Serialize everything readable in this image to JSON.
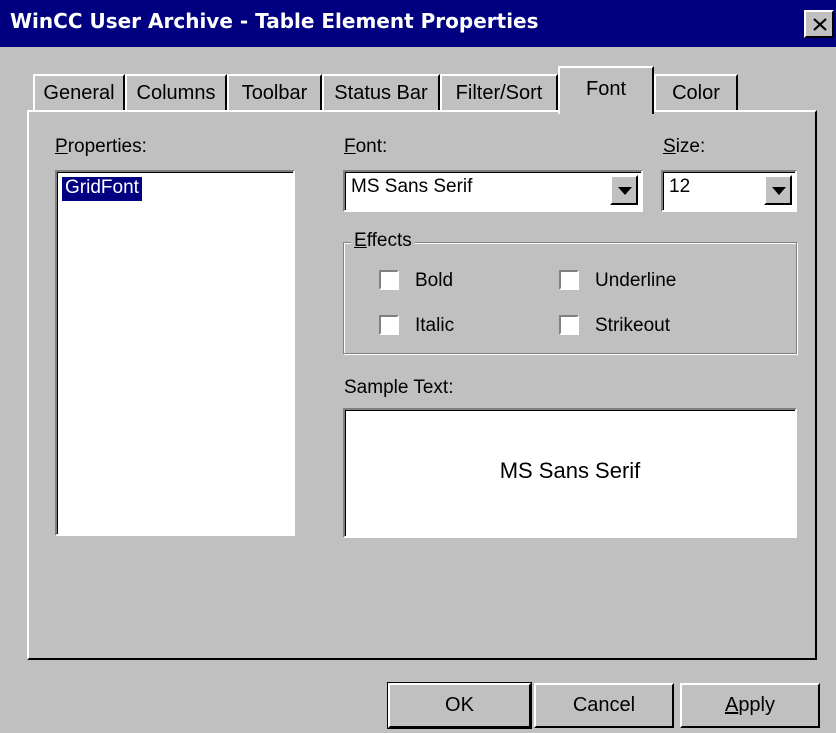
{
  "window": {
    "title": "WinCC User Archive - Table Element Properties"
  },
  "tabs": [
    {
      "label": "General"
    },
    {
      "label": "Columns"
    },
    {
      "label": "Toolbar"
    },
    {
      "label": "Status Bar"
    },
    {
      "label": "Filter/Sort"
    },
    {
      "label": "Font",
      "active": true
    },
    {
      "label": "Color"
    }
  ],
  "properties": {
    "label": "Properties:",
    "label_accel": "P",
    "label_rest": "roperties:",
    "items": [
      "GridFont"
    ],
    "selected": "GridFont"
  },
  "font": {
    "label_accel": "F",
    "label_rest": "ont:",
    "value": "MS Sans Serif"
  },
  "size": {
    "label_accel": "S",
    "label_rest": "ize:",
    "value": "12"
  },
  "effects": {
    "label_accel": "E",
    "label_rest": "ffects",
    "bold": {
      "label": "Bold",
      "checked": false
    },
    "italic": {
      "label": "Italic",
      "checked": false
    },
    "underline": {
      "label": "Underline",
      "checked": false
    },
    "strikeout": {
      "label": "Strikeout",
      "checked": false
    }
  },
  "sample": {
    "label": "Sample Text:",
    "text": "MS Sans Serif"
  },
  "buttons": {
    "ok": "OK",
    "cancel": "Cancel",
    "apply_accel": "A",
    "apply_rest": "pply"
  },
  "colors": {
    "face": "#c0c0c0",
    "titlebar": "#000080",
    "selection": "#000080"
  },
  "icons": {
    "close": "close-icon",
    "dropdown": "chevron-down-icon"
  }
}
